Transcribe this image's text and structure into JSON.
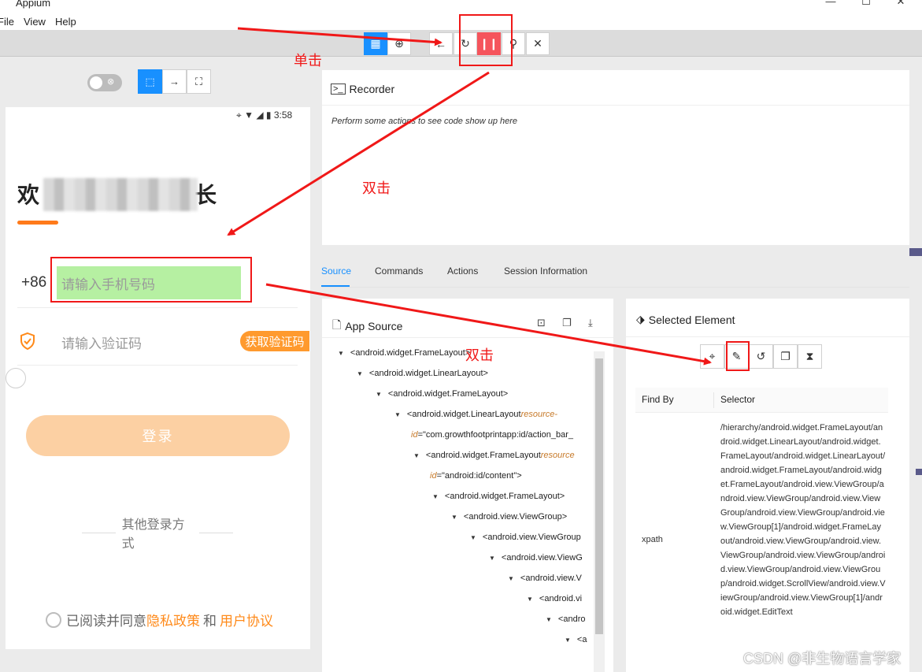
{
  "window": {
    "title": "Appium"
  },
  "menu": [
    "File",
    "View",
    "Help"
  ],
  "device": {
    "status_time": "3:58",
    "welcome": "欢",
    "welcome_suffix": "长",
    "country_code": "+86",
    "phone_placeholder": "请输入手机号码",
    "code_placeholder": "请输入验证码",
    "get_code": "获取验证码",
    "login": "登录",
    "other_login": "其他登录方式",
    "agree_prefix": "已阅读并同意",
    "privacy": "隐私政策",
    "and": "和",
    "user_agreement": "用户协议"
  },
  "recorder": {
    "title": "Recorder",
    "hint": "Perform some actions to see code show up here"
  },
  "tabs": [
    "Source",
    "Commands",
    "Actions",
    "Session Information"
  ],
  "app_source": {
    "title": "App Source",
    "rows": [
      {
        "tag": "<android.widget.FrameLayout>",
        "attr": "",
        "val": ""
      },
      {
        "tag": "<android.widget.LinearLayout>",
        "attr": "",
        "val": ""
      },
      {
        "tag": "<android.widget.FrameLayout>",
        "attr": "",
        "val": ""
      },
      {
        "tag": "<android.widget.LinearLayout",
        "attr": " resource-",
        "val": ""
      },
      {
        "tag": "",
        "attr": "id",
        "val": "=\"com.growthfootprintapp:id/action_bar_"
      },
      {
        "tag": "<android.widget.FrameLayout",
        "attr": " resource",
        "val": ""
      },
      {
        "tag": "",
        "attr": "id",
        "val": "=\"android:id/content\">"
      },
      {
        "tag": "<android.widget.FrameLayout>",
        "attr": "",
        "val": ""
      },
      {
        "tag": "<android.view.ViewGroup>",
        "attr": "",
        "val": ""
      },
      {
        "tag": "<android.view.ViewGroup",
        "attr": "",
        "val": ""
      },
      {
        "tag": "<android.view.ViewG",
        "attr": "",
        "val": ""
      },
      {
        "tag": "<android.view.V",
        "attr": "",
        "val": ""
      },
      {
        "tag": "<android.vi",
        "attr": "",
        "val": ""
      },
      {
        "tag": "<andro",
        "attr": "",
        "val": ""
      },
      {
        "tag": "<a",
        "attr": "",
        "val": ""
      }
    ]
  },
  "selected_element": {
    "title": "Selected Element",
    "col_find_by": "Find By",
    "col_selector": "Selector",
    "find_by": "xpath",
    "selector": "/hierarchy/android.widget.FrameLayout/android.widget.LinearLayout/android.widget.FrameLayout/android.widget.LinearLayout/android.widget.FrameLayout/android.widget.FrameLayout/android.view.ViewGroup/android.view.ViewGroup/android.view.ViewGroup/android.view.ViewGroup/android.view.ViewGroup[1]/android.widget.FrameLayout/android.view.ViewGroup/android.view.ViewGroup/android.view.ViewGroup/android.view.ViewGroup/android.view.ViewGroup/android.widget.ScrollView/android.view.ViewGroup/android.view.ViewGroup[1]/android.widget.EditText"
  },
  "annotations": {
    "single_click": "单击",
    "double_click_1": "双击",
    "double_click_2": "双击"
  },
  "watermark": "CSDN @非生物语言学家",
  "colors": {
    "accent": "#1890ff",
    "pause": "#f5545c",
    "annotation": "#f01818",
    "orange": "#ff7a1a",
    "highlight": "#b6f0a2"
  }
}
